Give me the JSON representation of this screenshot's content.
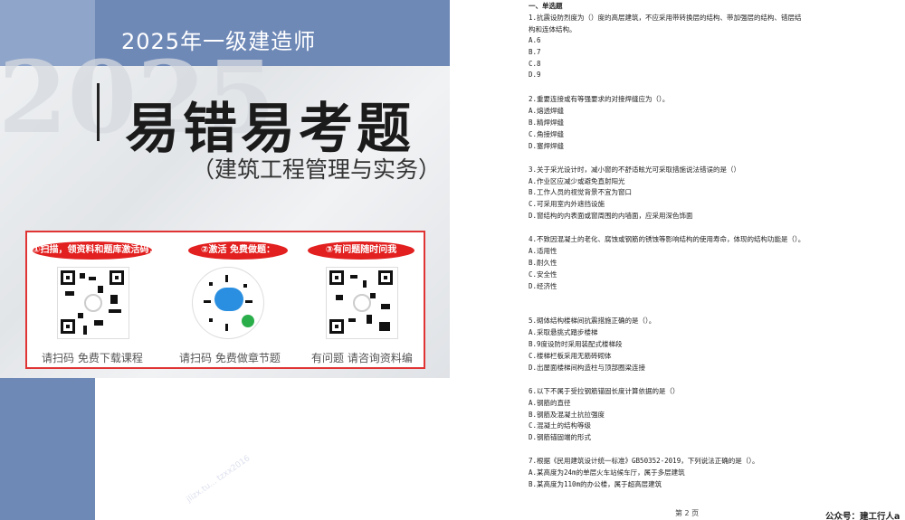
{
  "cover": {
    "year_title": "2025年一级建造师",
    "big_year": "2025",
    "main_title": "易错易考题",
    "subtitle": "（建筑工程管理与实务）",
    "qr_steps": [
      {
        "label": "①扫描，领资料和题库激活码：",
        "caption": "请扫码 免费下载课程"
      },
      {
        "label": "②激活 免费做题：",
        "caption": "请扫码 免费做章节题"
      },
      {
        "label": "③有问题随时问我",
        "caption": "有问题 请咨询资料编"
      }
    ],
    "watermark": "jlizx.tu...  tzxx2016"
  },
  "document": {
    "lines": [
      "一、单选题",
      "1.抗震设防烈度为（）度的高层建筑，不应采用带转换层的结构、带加强层的结构、错层结",
      "构和连体结构。",
      "A.6",
      "B.7",
      "C.8",
      "D.9",
      "",
      "2.重要连接或有等强要求的对接焊缝应为（）。",
      "A.熔透焊缝",
      "B.精焊焊缝",
      "C.角接焊缝",
      "D.塞焊焊缝",
      "",
      "3.关于采光设计时，减小窗的不舒适眩光可采取措施说法错误的是（）",
      "A.作业区应减少或避免直射阳光",
      "B.工作人员的视觉背景不宜为窗口",
      "C.可采用室内外遮挡设施",
      "D.窗结构的内表面或窗周围的内墙面，应采用深色饰面",
      "",
      "4.不致因混凝土的老化、腐蚀或钢筋的锈蚀等影响结构的使用寿命，体现的结构功能是（）。",
      "A.适用性",
      "B.耐久性",
      "C.安全性",
      "D.经济性",
      "",
      "",
      "5.砌体结构楼梯间抗震措施正确的是（）。",
      "A.采取悬挑式踏步楼梯",
      "B.9度设防时采用装配式楼梯段",
      "C.楼梯栏板采用无筋砖砌体",
      "D.出屋面楼梯间构造柱与顶部圈梁连接",
      "",
      "6.以下不属于受拉钢筋锚固长度计算依据的是（）",
      "A.钢筋的直径",
      "B.钢筋及混凝土抗拉强度",
      "C.混凝土的结构等级",
      "D.钢筋锚固端的形式",
      "",
      "7.根据《民用建筑设计统一标准》GB50352-2019，下列说法正确的是（）。",
      "A.某高度为24m的单层火车站候车厅，属于多层建筑",
      "B.某高度为110m的办公楼，属于超高层建筑"
    ],
    "page_number": "第 2 页",
    "wechat_account": "公众号：建工行人a"
  }
}
